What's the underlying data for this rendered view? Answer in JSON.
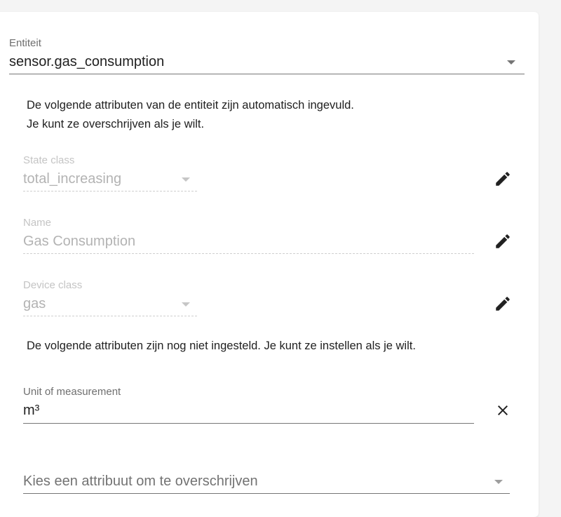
{
  "entity": {
    "label": "Entiteit",
    "value": "sensor.gas_consumption"
  },
  "info_auto": {
    "line1": "De volgende attributen van de entiteit zijn automatisch ingevuld.",
    "line2": "Je kunt ze overschrijven als je wilt."
  },
  "attributes": [
    {
      "label": "State class",
      "value": "total_increasing",
      "icon": "pencil-icon"
    },
    {
      "label": "Name",
      "value": "Gas Consumption",
      "icon": "pencil-icon"
    },
    {
      "label": "Device class",
      "value": "gas",
      "icon": "pencil-icon"
    }
  ],
  "info_unset": {
    "text": "De volgende attributen zijn nog niet ingesteld. Je kunt ze instellen als je wilt."
  },
  "unit": {
    "label": "Unit of measurement",
    "value": "m³",
    "icon": "close-icon"
  },
  "override_select": {
    "placeholder": "Kies een attribuut om te overschrijven"
  },
  "colors": {
    "text": "#212121",
    "disabled": "#b3b3b3",
    "icon": "#212121"
  }
}
